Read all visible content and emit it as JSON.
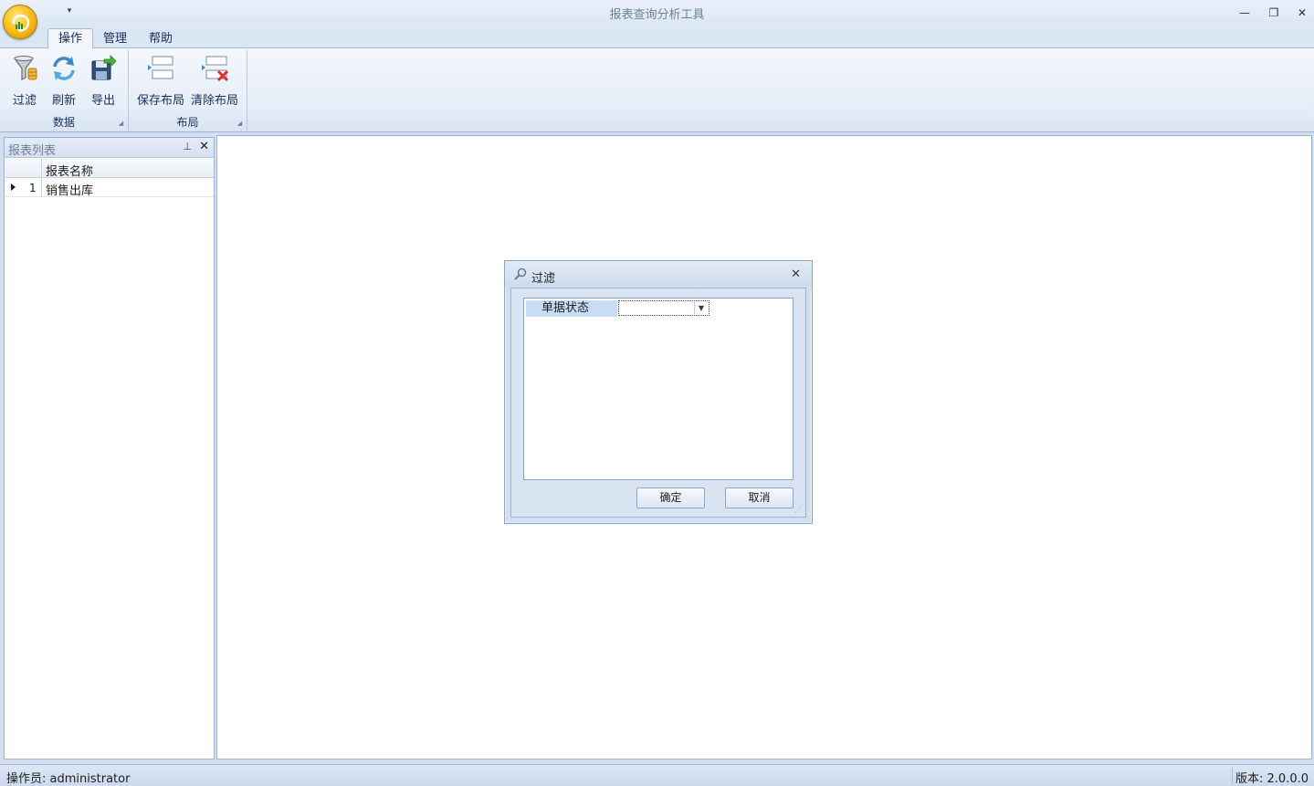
{
  "window": {
    "title": "报表查询分析工具",
    "qat_dropdown": "▾",
    "minimize": "—",
    "restore": "❐",
    "close": "✕"
  },
  "ribbon": {
    "tabs": [
      {
        "label": "操作",
        "active": true
      },
      {
        "label": "管理",
        "active": false
      },
      {
        "label": "帮助",
        "active": false
      }
    ],
    "groups": [
      {
        "title": "数据",
        "buttons": [
          {
            "label": "过滤",
            "icon": "filter-icon"
          },
          {
            "label": "刷新",
            "icon": "refresh-icon"
          },
          {
            "label": "导出",
            "icon": "export-icon"
          }
        ]
      },
      {
        "title": "布局",
        "buttons": [
          {
            "label": "保存布局",
            "icon": "save-layout-icon"
          },
          {
            "label": "清除布局",
            "icon": "clear-layout-icon"
          }
        ]
      }
    ]
  },
  "report_panel": {
    "title": "报表列表",
    "pin": "⊥",
    "close": "✕",
    "column_header": "报表名称",
    "rows": [
      {
        "index": "1",
        "name": "销售出库"
      }
    ]
  },
  "filter_dialog": {
    "title": "过滤",
    "close": "✕",
    "field_label": "单据状态",
    "field_value": "",
    "ok_label": "确定",
    "cancel_label": "取消"
  },
  "status": {
    "operator": "操作员: administrator",
    "version": "版本: 2.0.0.0"
  },
  "colors": {
    "ribbon_bg": "#e6eef8",
    "highlight": "#c7dcf5",
    "border": "#9fb3d0"
  }
}
